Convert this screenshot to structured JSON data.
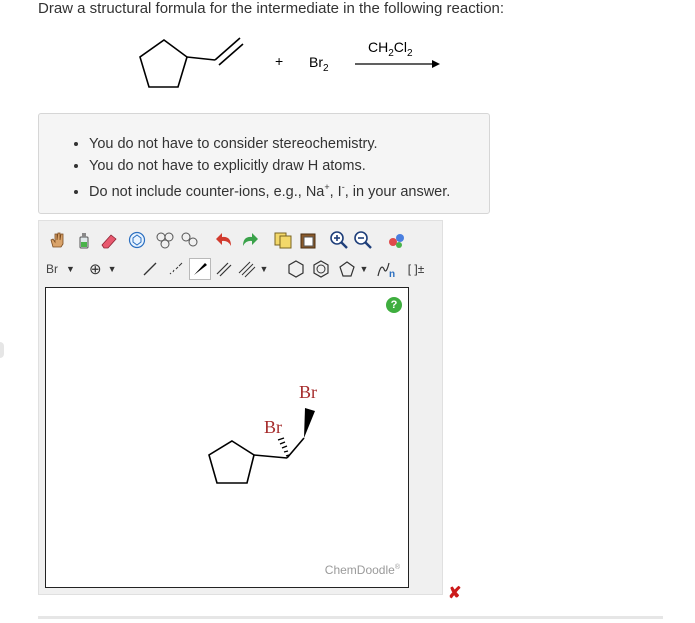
{
  "question": "Draw a structural formula for the intermediate in the following reaction:",
  "reaction": {
    "plus": "+",
    "reagent": "Br",
    "reagent_sub": "2",
    "solvent_main": "CH",
    "solvent_sub1": "2",
    "solvent_cl": "Cl",
    "solvent_sub2": "2"
  },
  "hints": {
    "item1": "You do not have to consider stereochemistry.",
    "item2": "You do not have to explicitly draw H atoms.",
    "item3_pre": "Do not include counter-ions, e.g., Na",
    "item3_sup1": "+",
    "item3_mid": ", I",
    "item3_sup2": "-",
    "item3_post": ", in your answer."
  },
  "toolbar": {
    "element_label": "Br",
    "charge_label": "⊕",
    "bracket_label": "[ ]±"
  },
  "canvas": {
    "atom_br1": "Br",
    "atom_br2": "Br",
    "help_label": "?",
    "watermark": "ChemDoodle",
    "watermark_sup": "®"
  },
  "status": {
    "incorrect_mark": "✘"
  },
  "colors": {
    "bromine": "#a52a2a",
    "help": "#3fae3f",
    "incorrect": "#cc1b1b"
  }
}
